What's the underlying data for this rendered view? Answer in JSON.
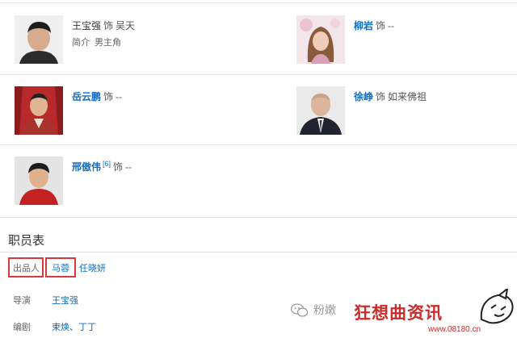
{
  "cast": [
    {
      "actor": "王宝强",
      "role_sep": "饰",
      "role": "吴天",
      "intro_label": "简介",
      "intro_value": "男主角",
      "name_linked": false
    },
    {
      "actor": "柳岩",
      "role_sep": "饰",
      "role": "--",
      "name_linked": true
    },
    {
      "actor": "岳云鹏",
      "role_sep": "饰",
      "role": "--",
      "name_linked": true
    },
    {
      "actor": "徐峥",
      "role_sep": "饰",
      "role": "如来佛祖",
      "name_linked": true
    },
    {
      "actor": "邢傲伟",
      "ref": "[6]",
      "role_sep": "饰",
      "role": "--",
      "name_linked": true
    }
  ],
  "crew": {
    "title": "职员表",
    "rows": [
      {
        "label": "出品人",
        "members": [
          "马蓉",
          "任晓妍"
        ]
      },
      {
        "label": "导演",
        "members": [
          "王宝强"
        ]
      },
      {
        "label": "编剧",
        "members": [
          "束焕、丁丁"
        ]
      }
    ]
  },
  "highlight_color": "#d9393a",
  "watermark": {
    "account": "粉嫩",
    "brand": "狂想曲资讯",
    "url": "www.08180.cn"
  }
}
